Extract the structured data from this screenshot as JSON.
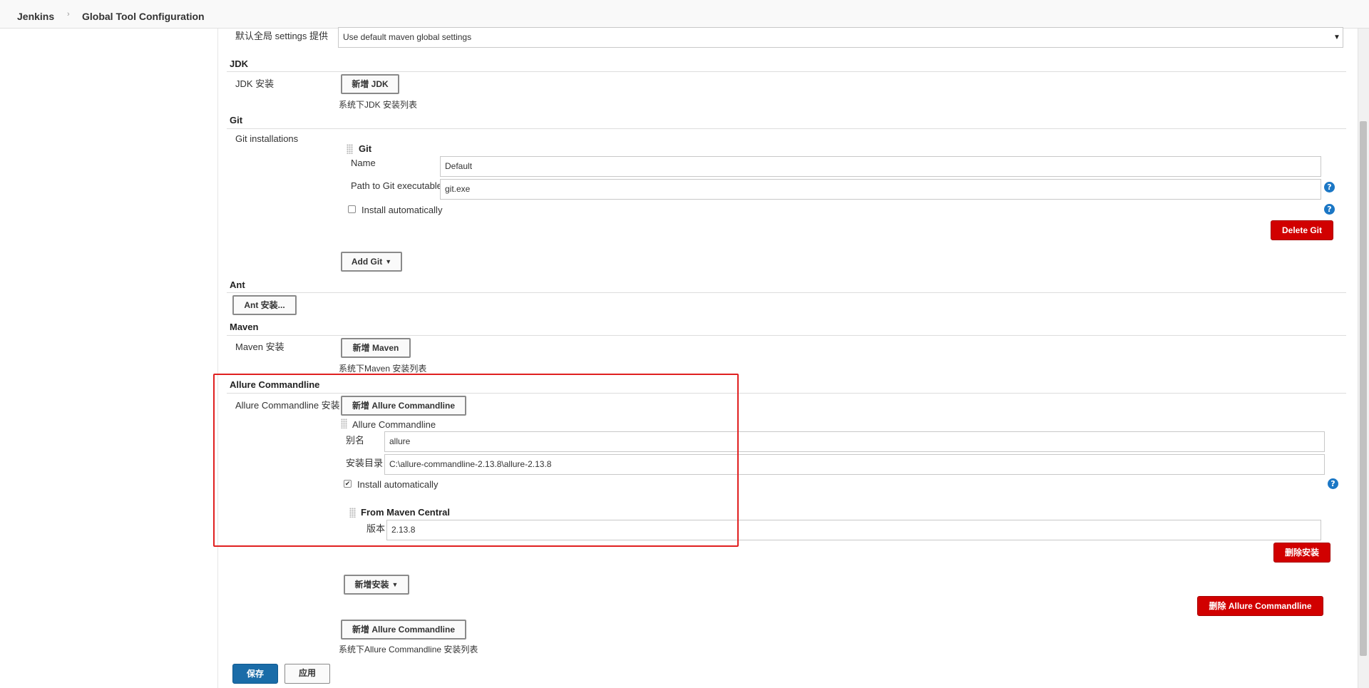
{
  "breadcrumb": {
    "root": "Jenkins",
    "page": "Global Tool Configuration"
  },
  "maven_global": {
    "label": "默认全局 settings 提供",
    "value": "Use default maven global settings"
  },
  "jdk": {
    "title": "JDK",
    "label": "JDK 安装",
    "add_button": "新增 JDK",
    "description": "系统下JDK 安装列表"
  },
  "git": {
    "title": "Git",
    "installations_label": "Git installations",
    "item_title": "Git",
    "name_label": "Name",
    "name_value": "Default",
    "path_label": "Path to Git executable",
    "path_value": "git.exe",
    "install_auto_label": "Install automatically",
    "delete_button": "Delete Git",
    "add_button": "Add Git"
  },
  "ant": {
    "title": "Ant",
    "add_button": "Ant 安装..."
  },
  "maven": {
    "title": "Maven",
    "label": "Maven 安装",
    "add_button": "新增 Maven",
    "description": "系统下Maven 安装列表"
  },
  "allure": {
    "title": "Allure Commandline",
    "label": "Allure Commandline 安装",
    "add_button_top": "新增 Allure Commandline",
    "item_title": "Allure Commandline",
    "alias_label": "别名",
    "alias_value": "allure",
    "dir_label": "安装目录",
    "dir_value": "C:\\allure-commandline-2.13.8\\allure-2.13.8",
    "install_auto_label": "Install automatically",
    "install_auto_checked": true,
    "installer_title": "From Maven Central",
    "version_label": "版本",
    "version_value": "2.13.8",
    "delete_install_button": "删除安装",
    "add_install_button": "新增安装",
    "delete_allure_button": "删除 Allure Commandline",
    "add_button_bottom": "新增 Allure Commandline",
    "description": "系统下Allure Commandline 安装列表"
  },
  "actions": {
    "save": "保存",
    "apply": "应用"
  },
  "colors": {
    "danger": "#d10000",
    "primary": "#1a6ca8",
    "help": "#1b77c5",
    "highlight": "#e02020"
  }
}
